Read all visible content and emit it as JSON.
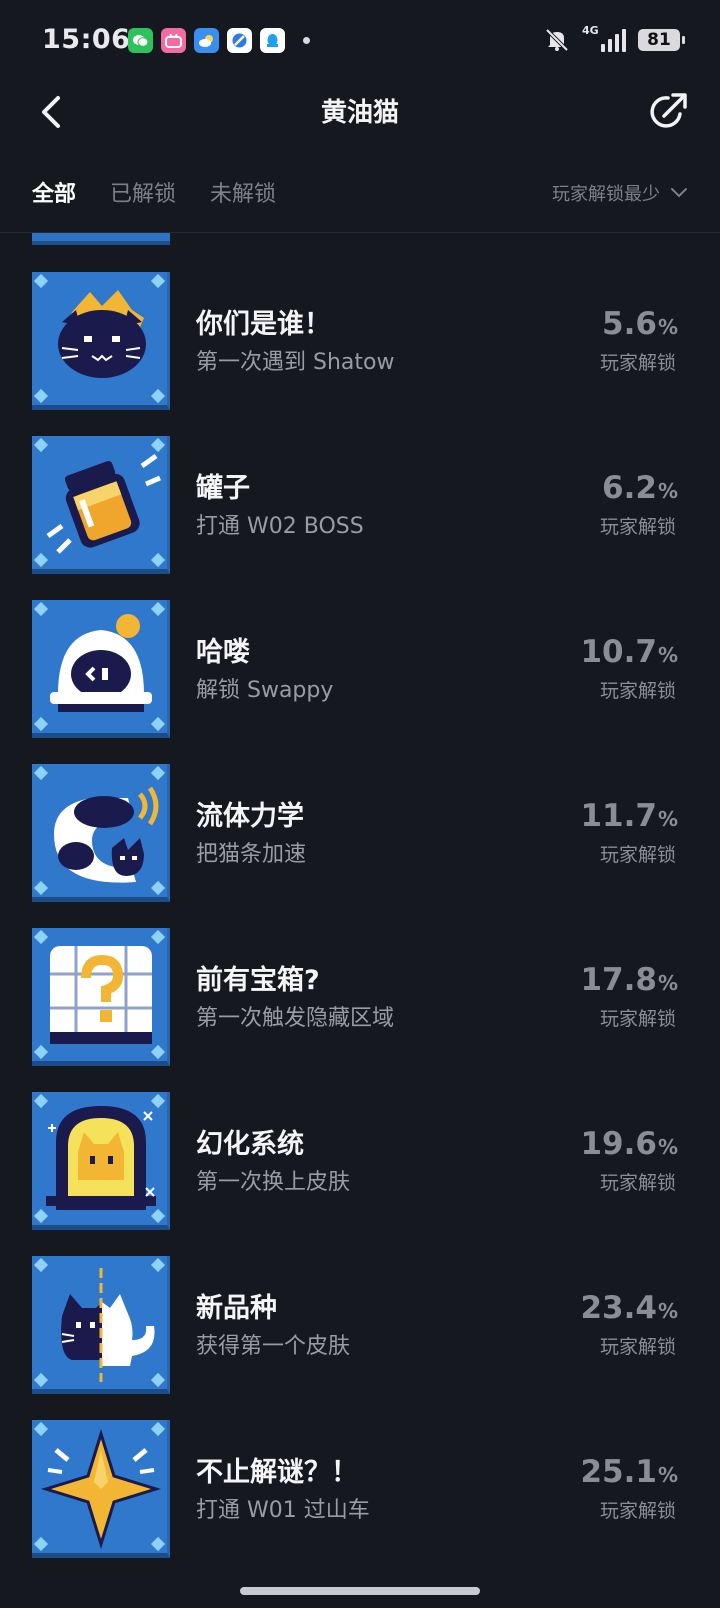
{
  "status_bar": {
    "time": "15:06",
    "network": "4G",
    "battery": "81"
  },
  "header": {
    "title": "黄油猫"
  },
  "tabs": [
    {
      "label": "全部",
      "active": true
    },
    {
      "label": "已解锁",
      "active": false
    },
    {
      "label": "未解锁",
      "active": false
    }
  ],
  "sort": {
    "label": "玩家解锁最少"
  },
  "unlock_label": "玩家解锁",
  "achievements": [
    {
      "name": "你们是谁！",
      "desc": "第一次遇到 Shatow",
      "pct": "5.6",
      "unit": "%",
      "icon": "shadow-cat-icon"
    },
    {
      "name": "罐子",
      "desc": "打通 W02 BOSS",
      "pct": "6.2",
      "unit": "%",
      "icon": "jar-icon"
    },
    {
      "name": "哈喽",
      "desc": "解锁 Swappy",
      "pct": "10.7",
      "unit": "%",
      "icon": "swappy-robot-icon"
    },
    {
      "name": "流体力学",
      "desc": "把猫条加速",
      "pct": "11.7",
      "unit": "%",
      "icon": "fluid-cat-icon"
    },
    {
      "name": "前有宝箱?",
      "desc": "第一次触发隐藏区域",
      "pct": "17.8",
      "unit": "%",
      "icon": "mystery-chest-icon"
    },
    {
      "name": "幻化系统",
      "desc": "第一次换上皮肤",
      "pct": "19.6",
      "unit": "%",
      "icon": "skin-mirror-icon"
    },
    {
      "name": "新品种",
      "desc": "获得第一个皮肤",
      "pct": "23.4",
      "unit": "%",
      "icon": "half-cat-icon"
    },
    {
      "name": "不止解谜？！",
      "desc": "打通 W01 过山车",
      "pct": "25.1",
      "unit": "%",
      "icon": "gold-star-icon"
    }
  ],
  "colors": {
    "background": "#16181f",
    "icon_bg": "#2f78cc",
    "text_primary": "#f5f5f8",
    "text_secondary": "#9a9ca4"
  }
}
